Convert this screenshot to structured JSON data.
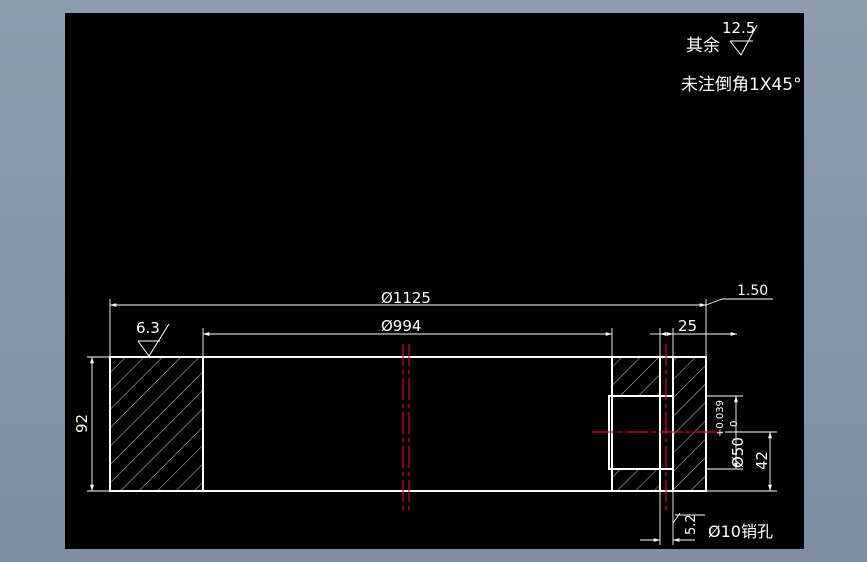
{
  "notes": {
    "roughness_prefix": "其余",
    "roughness_value": "12.5",
    "chamfer_note": "未注倒角1X45°"
  },
  "dims": {
    "outer_diameter": "Ø1125",
    "inner_diameter": "Ø994",
    "height": "92",
    "roughness_left": "6.3",
    "groove_width": "25",
    "groove_offset": "1.50",
    "bore_diameter": "Ø50",
    "bore_tol_upper": "+0.039",
    "bore_tol_lower": "0",
    "bore_position": "42",
    "pin_offset": "5.2",
    "pin_hole": "Ø10销孔"
  },
  "colors": {
    "background": "#000000",
    "frame": "#8e9cae",
    "outline": "#ffffff",
    "centerline": "#e0002a",
    "dimension": "#ffffff"
  }
}
